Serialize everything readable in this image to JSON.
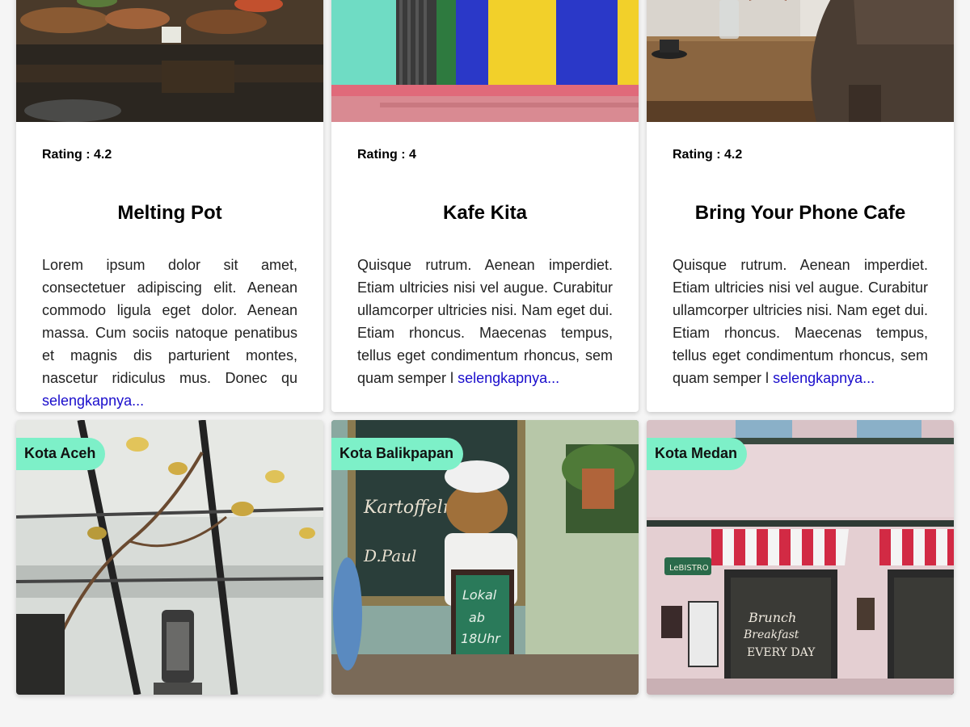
{
  "cafes": [
    {
      "rating": "Rating : 4.2",
      "name": "Melting Pot",
      "description": "Lorem ipsum dolor sit amet, consectetuer adipiscing elit. Aenean commodo ligula eget dolor. Aenean massa. Cum sociis natoque penatibus et magnis dis parturient montes, nascetur ridiculus mus. Donec qu ",
      "more": "selengkapnya...",
      "image": "bakery-display-photo"
    },
    {
      "rating": "Rating : 4",
      "name": "Kafe Kita",
      "description": "Quisque rutrum. Aenean imperdiet. Etiam ultricies nisi vel augue. Curabitur ullamcorper ultricies nisi. Nam eget dui. Etiam rhoncus. Maecenas tempus, tellus eget condimentum rhoncus, sem quam semper l ",
      "more": "selengkapnya...",
      "image": "colorful-door-photo"
    },
    {
      "rating": "Rating : 4.2",
      "name": "Bring Your Phone Cafe",
      "description": "Quisque rutrum. Aenean imperdiet. Etiam ultricies nisi vel augue. Curabitur ullamcorper ultricies nisi. Nam eget dui. Etiam rhoncus. Maecenas tempus, tellus eget condimentum rhoncus, sem quam semper l ",
      "more": "selengkapnya...",
      "image": "cafe-table-photo"
    }
  ],
  "cities": [
    {
      "label": "Kota Aceh",
      "image": "greenhouse-plant-photo"
    },
    {
      "label": "Kota Balikpapan",
      "image": "chalkboard-teddy-photo"
    },
    {
      "label": "Kota Medan",
      "image": "bistro-storefront-photo"
    }
  ],
  "colors": {
    "badge": "#7df0c8",
    "link": "#1a0dcc"
  }
}
